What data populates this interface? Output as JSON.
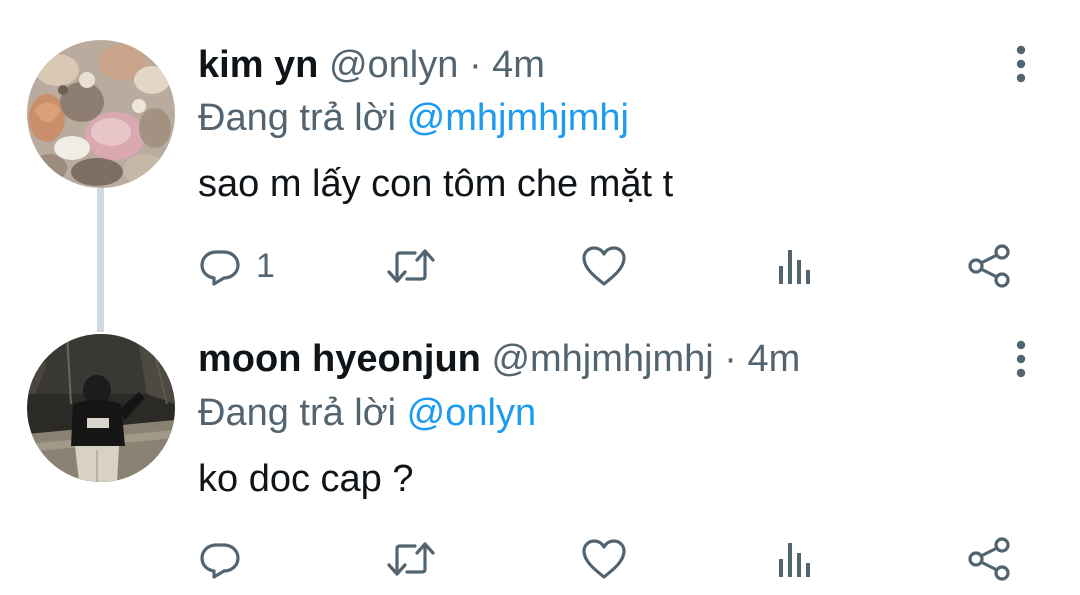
{
  "tweets": [
    {
      "display_name": "kim yn",
      "handle": "@onlyn",
      "separator": "·",
      "time": "4m",
      "reply_prefix": "Đang trả lời",
      "reply_mention": "@mhjmhjmhj",
      "text": "sao m lấy con tôm che mặt t",
      "reply_count": "1",
      "avatar": "seashells-photo"
    },
    {
      "display_name": "moon hyeonjun",
      "handle": "@mhjmhjmhj",
      "separator": "·",
      "time": "4m",
      "reply_prefix": "Đang trả lời",
      "reply_mention": "@onlyn",
      "text": "ko doc cap ?",
      "reply_count": "",
      "avatar": "person-at-night-photo"
    }
  ],
  "icons": {
    "reply": "speech-bubble-icon",
    "retweet": "retweet-arrows-icon",
    "like": "heart-icon",
    "views": "bar-chart-icon",
    "share": "share-nodes-icon",
    "more": "vertical-ellipsis-icon"
  },
  "colors": {
    "text": "#0f1419",
    "secondary": "#536471",
    "mention": "#1d9bf0",
    "thread_line": "#cfd9de"
  }
}
